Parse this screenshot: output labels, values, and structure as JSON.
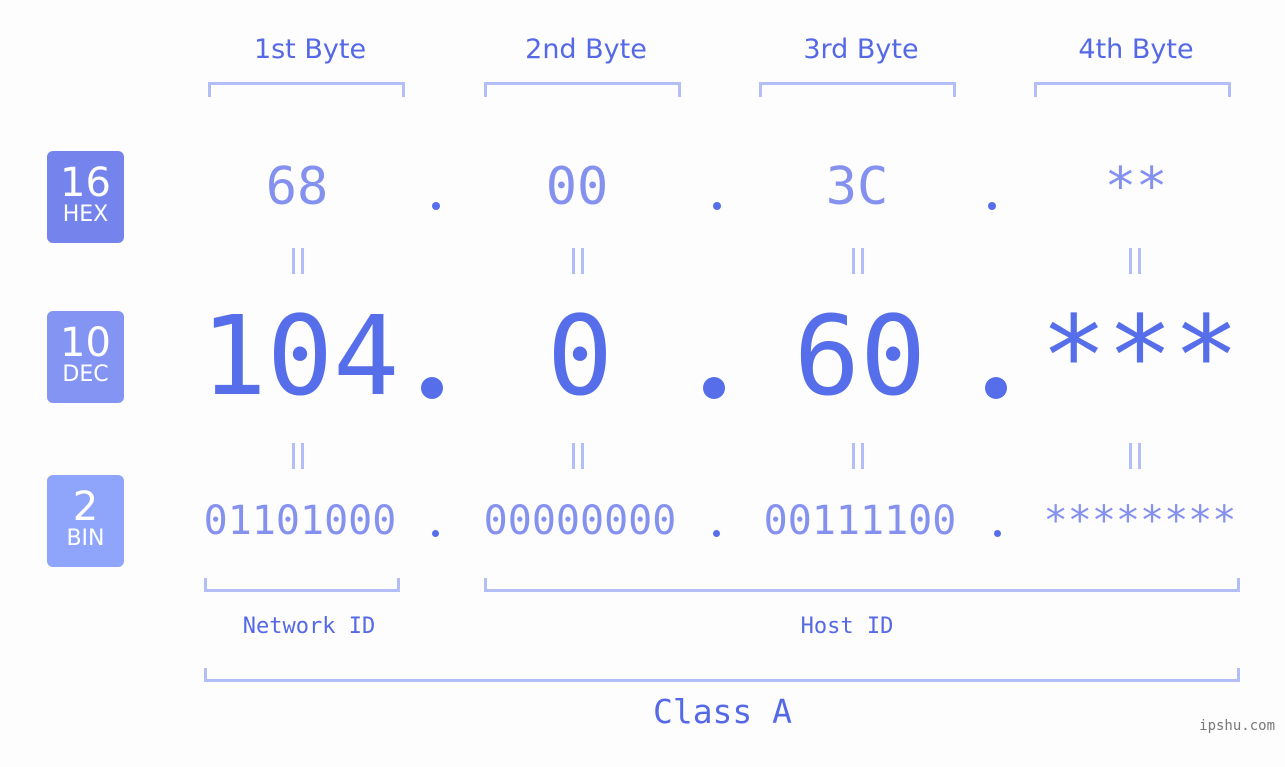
{
  "bytes": [
    {
      "header": "1st Byte",
      "hex": "68",
      "dec": "104",
      "bin": "01101000"
    },
    {
      "header": "2nd Byte",
      "hex": "00",
      "dec": "0",
      "bin": "00000000"
    },
    {
      "header": "3rd Byte",
      "hex": "3C",
      "dec": "60",
      "bin": "00111100"
    },
    {
      "header": "4th Byte",
      "hex": "**",
      "dec": "***",
      "bin": "********"
    }
  ],
  "badges": {
    "hex": {
      "number": "16",
      "label": "HEX",
      "color": "#7583ed"
    },
    "dec": {
      "number": "10",
      "label": "DEC",
      "color": "#8494f3"
    },
    "bin": {
      "number": "2",
      "label": "BIN",
      "color": "#8fa5fb"
    }
  },
  "labels": {
    "network_id": "Network ID",
    "host_id": "Host ID",
    "class": "Class A"
  },
  "watermark": "ipshu.com",
  "colors": {
    "accent": "#566ee9",
    "light_accent": "#8591ee",
    "bracket": "#b3bdf6",
    "background": "#fcfdfc"
  }
}
